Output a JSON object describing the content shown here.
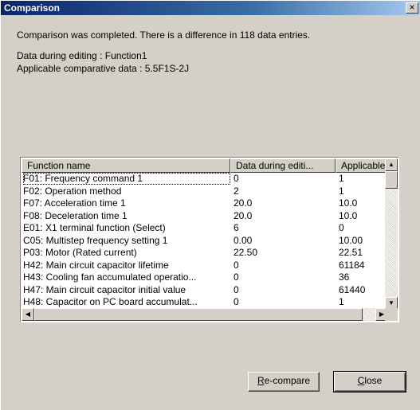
{
  "window": {
    "title": "Comparison",
    "close_glyph": "×"
  },
  "messages": {
    "summary": "Comparison was completed. There is a difference in 118 data entries.",
    "editing": "Data during editing : Function1",
    "applicable": "Applicable comparative data : 5.5F1S-2J"
  },
  "table": {
    "columns": [
      "Function name",
      "Data during editi...",
      "Applicable"
    ],
    "rows": [
      [
        "F01: Frequency command 1",
        "0",
        "1"
      ],
      [
        "F02: Operation method",
        "2",
        "1"
      ],
      [
        "F07: Acceleration time 1",
        "20.0",
        "10.0"
      ],
      [
        "F08: Deceleration time 1",
        "20.0",
        "10.0"
      ],
      [
        "E01: X1 terminal function (Select)",
        "6",
        "0"
      ],
      [
        "C05: Multistep frequency setting 1",
        "0.00",
        "10.00"
      ],
      [
        "P03: Motor (Rated current)",
        "22.50",
        "22.51"
      ],
      [
        "H42: Main circuit capacitor lifetime",
        "0",
        "61184"
      ],
      [
        "H43: Cooling fan accumulated operatio...",
        "0",
        "36"
      ],
      [
        "H47: Main circuit capacitor initial value",
        "0",
        "61440"
      ],
      [
        "H48: Capacitor on PC board accumulat...",
        "0",
        "1"
      ]
    ]
  },
  "buttons": {
    "recompare_key": "R",
    "recompare_rest": "e-compare",
    "close_key": "C",
    "close_rest": "lose"
  },
  "icons": {
    "scroll_up": "▲",
    "scroll_down": "▼",
    "scroll_left": "◀",
    "scroll_right": "▶"
  }
}
